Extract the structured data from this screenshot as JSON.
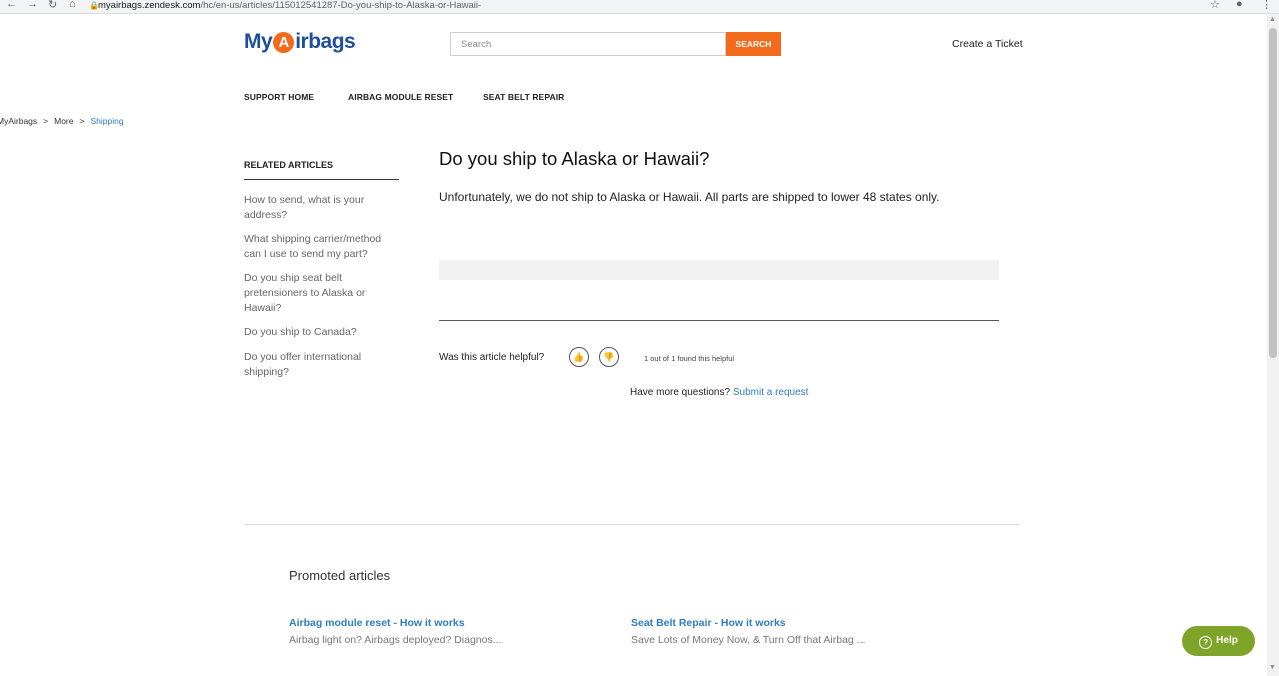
{
  "browser": {
    "url_host": "myairbags.zendesk.com",
    "url_path": "/hc/en-us/articles/115012541287-Do-you-ship-to-Alaska-or-Hawaii-"
  },
  "header": {
    "logo_my": "My",
    "logo_a": "A",
    "logo_rest": "irbags",
    "search_placeholder": "Search",
    "search_button": "SEARCH",
    "create_ticket": "Create a Ticket"
  },
  "nav": {
    "items": [
      "SUPPORT HOME",
      "AIRBAG MODULE RESET",
      "SEAT BELT REPAIR"
    ]
  },
  "breadcrumb": {
    "items": [
      "MyAirbags",
      "More",
      "Shipping"
    ],
    "separator": ">"
  },
  "sidebar": {
    "title": "RELATED ARTICLES",
    "items": [
      "How to send, what is your address?",
      "What shipping carrier/method can I use to send my part?",
      "Do you ship seat belt pretensioners to Alaska or Hawaii?",
      "Do you ship to Canada?",
      "Do you offer international shipping?"
    ]
  },
  "article": {
    "title": "Do you ship to Alaska or Hawaii?",
    "body": "Unfortunately, we do not ship to Alaska or Hawaii. All parts are shipped to lower 48 states only.",
    "helpful_question": "Was this article helpful?",
    "helpful_count": "1 out of 1 found this helpful",
    "more_questions": "Have more questions?",
    "submit_request": "Submit a request"
  },
  "promoted": {
    "title": "Promoted articles",
    "items": [
      {
        "title": "Airbag module reset - How it works",
        "desc": "Airbag light on? Airbags deployed? Diagnos..."
      },
      {
        "title": "Seat Belt Repair - How it works",
        "desc": "Save Lots of Money Now, & Turn Off that Airbag ..."
      }
    ]
  },
  "help_widget": {
    "label": "Help",
    "icon": "question-icon"
  }
}
